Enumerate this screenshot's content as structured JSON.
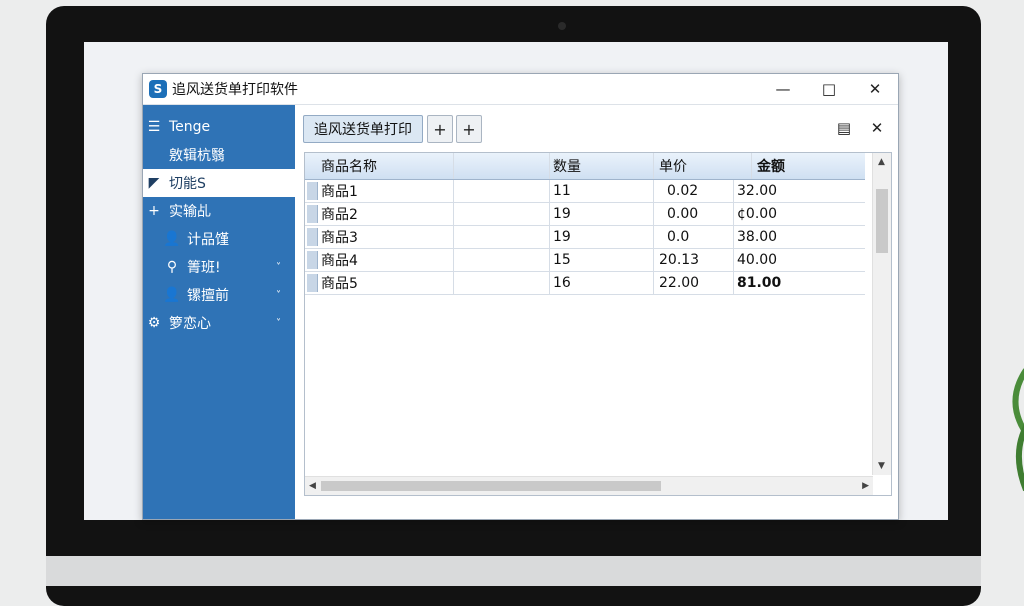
{
  "window": {
    "title": "追风送货单打印软件",
    "logo_glyph": "S",
    "controls": {
      "minimize": "—",
      "maximize": "□",
      "close": "✕"
    }
  },
  "sidebar": {
    "items": [
      {
        "icon": "☰",
        "icon_name": "menu-icon",
        "label": "Tenge",
        "chevron": ""
      },
      {
        "icon": "",
        "icon_name": "",
        "label": "敫辑杭翳",
        "chevron": ""
      },
      {
        "icon": "◤",
        "icon_name": "send-icon",
        "label": "切能S",
        "chevron": "",
        "active": true
      },
      {
        "icon": "+",
        "icon_name": "plus-icon",
        "label": "实输乩",
        "chevron": ""
      },
      {
        "icon": "👤",
        "icon_name": "user-icon",
        "label": "计品馑",
        "chevron": ""
      },
      {
        "icon": "⚲",
        "icon_name": "search-icon",
        "label": "箐班!",
        "chevron": "˅"
      },
      {
        "icon": "👤",
        "icon_name": "person-icon",
        "label": "镙擅前",
        "chevron": "˅"
      },
      {
        "icon": "⚙",
        "icon_name": "gear-icon",
        "label": "箩恋心",
        "chevron": "˅"
      }
    ]
  },
  "toolbar": {
    "tab_label": "追风送货单打印",
    "add1": "+",
    "add2": "+",
    "doc_icon": "▤",
    "close_icon": "✕"
  },
  "grid": {
    "columns": [
      "商品名称",
      "",
      "数量",
      "单价",
      "金额"
    ],
    "rows": [
      [
        "商品1",
        "",
        "11",
        "0.02",
        "32.00"
      ],
      [
        "商品2",
        "",
        "19",
        "0.00",
        "¢0.00"
      ],
      [
        "商品3",
        "",
        "19",
        "0.0",
        "38.00"
      ],
      [
        "商品4",
        "",
        "15",
        "20.13",
        "40.00"
      ],
      [
        "商品5",
        "",
        "16",
        "22.00",
        "81.00"
      ]
    ]
  },
  "colors": {
    "sidebar": "#2f73b6",
    "header": "#cfe0f2",
    "accent": "#1c6fb8"
  }
}
